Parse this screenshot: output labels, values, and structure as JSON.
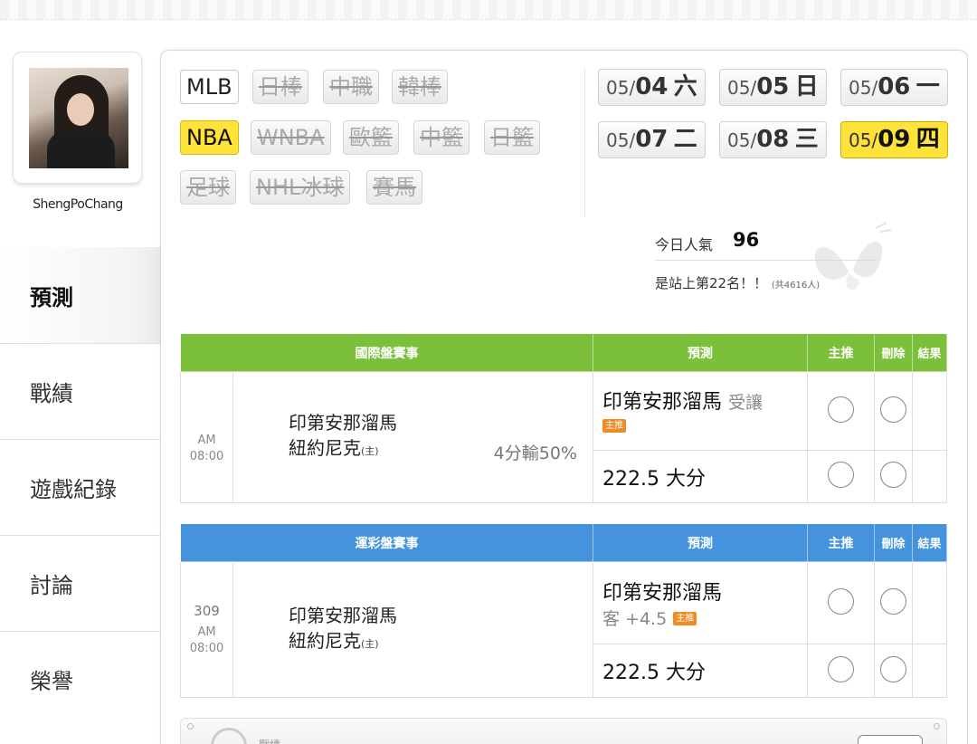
{
  "profile": {
    "username": "ShengPoChang"
  },
  "nav": [
    {
      "label": "預測",
      "active": true
    },
    {
      "label": "戰績",
      "active": false
    },
    {
      "label": "遊戲紀錄",
      "active": false
    },
    {
      "label": "討論",
      "active": false
    },
    {
      "label": "榮譽",
      "active": false
    }
  ],
  "sports": [
    {
      "label": "MLB",
      "state": "on"
    },
    {
      "label": "日棒",
      "state": "disabled"
    },
    {
      "label": "中職",
      "state": "disabled"
    },
    {
      "label": "韓棒",
      "state": "disabled"
    },
    {
      "label": "NBA",
      "state": "selected"
    },
    {
      "label": "WNBA",
      "state": "disabled"
    },
    {
      "label": "歐籃",
      "state": "disabled"
    },
    {
      "label": "中籃",
      "state": "disabled"
    },
    {
      "label": "日籃",
      "state": "disabled"
    },
    {
      "label": "足球",
      "state": "disabled"
    },
    {
      "label": "NHL冰球",
      "state": "disabled"
    },
    {
      "label": "賽馬",
      "state": "disabled"
    }
  ],
  "dates": [
    {
      "month": "05/",
      "day": "04",
      "weekday": "六"
    },
    {
      "month": "05/",
      "day": "05",
      "weekday": "日"
    },
    {
      "month": "05/",
      "day": "06",
      "weekday": "一"
    },
    {
      "month": "05/",
      "day": "07",
      "weekday": "二"
    },
    {
      "month": "05/",
      "day": "08",
      "weekday": "三"
    },
    {
      "month": "05/",
      "day": "09",
      "weekday": "四",
      "selected": true
    }
  ],
  "popularity": {
    "label": "今日人氣",
    "value": "96",
    "rank_text": "是站上第22名！！",
    "rank_total": "(共4616人)"
  },
  "intl_table": {
    "header": {
      "event": "國際盤賽事",
      "prediction": "預測",
      "main": "主推",
      "delete": "刪除",
      "result": "結果"
    },
    "time": "AM",
    "clock": "08:00",
    "away_team": "印第安那溜馬",
    "home_team": "紐約尼克",
    "home_mark": "(主)",
    "odds": "4分輸50%",
    "pick1_team": "印第安那溜馬",
    "pick1_sub": "受讓",
    "pick_badge": "主推",
    "pick2": "222.5 大分"
  },
  "lottery_table": {
    "header": {
      "event": "運彩盤賽事",
      "prediction": "預測",
      "main": "主推",
      "delete": "刪除",
      "result": "結果"
    },
    "number": "309",
    "time": "AM",
    "clock": "08:00",
    "away_team": "印第安那溜馬",
    "home_team": "紐約尼克",
    "home_mark": "(主)",
    "pick1_team": "印第安那溜馬",
    "pick1_sub": "客 +4.5",
    "pick_badge": "主推",
    "pick2": "222.5 大分"
  },
  "bottom": {
    "label": "戰績"
  },
  "colors": {
    "green_header": "#7cbf3a",
    "blue_header": "#4493dc",
    "highlight": "#ffe23a",
    "badge": "#f08a24"
  }
}
